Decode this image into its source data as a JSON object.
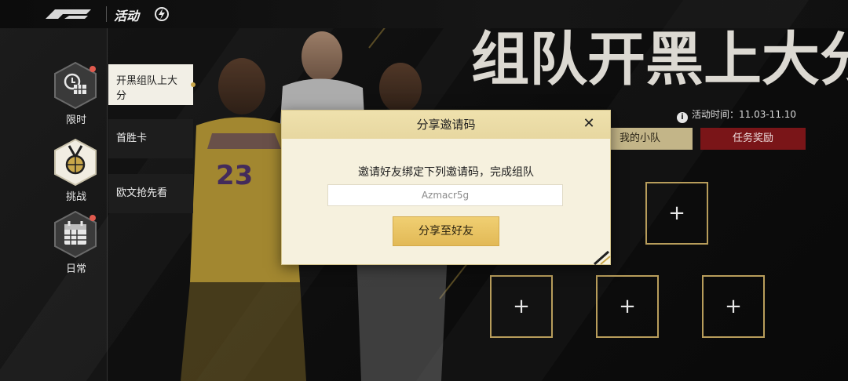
{
  "topbar": {
    "logo_icon": "nba-logo-icon",
    "title": "活动",
    "bolt_icon": "lightning-icon"
  },
  "rail": [
    {
      "label": "限时",
      "icon": "clock-calendar-icon",
      "has_dot": true
    },
    {
      "label": "挑战",
      "icon": "medal-icon",
      "has_dot": false
    },
    {
      "label": "日常",
      "icon": "calendar-icon",
      "has_dot": true
    }
  ],
  "subtabs": [
    {
      "label": "开黑组队上大分",
      "active": true
    },
    {
      "label": "首胜卡",
      "active": false
    },
    {
      "label": "欧文抢先看",
      "active": false
    }
  ],
  "event": {
    "title": "组队开黑上大分",
    "time_label": "活动时间：11.03-11.10",
    "info_icon": "info-icon",
    "tab_team": "我的小队",
    "tab_task": "任务奖励",
    "slot_plus": "+"
  },
  "dialog": {
    "title": "分享邀请码",
    "close": "✕",
    "prompt": "邀请好友绑定下列邀请码，完成组队",
    "code": "Azmacr5g",
    "share_button": "分享至好友"
  },
  "colors": {
    "accent_gold": "#c9a74a",
    "task_red": "#7a1518",
    "team_tan": "#c3b588",
    "dialog_bg": "#f6f1de",
    "notify_red": "#e05a4e"
  }
}
